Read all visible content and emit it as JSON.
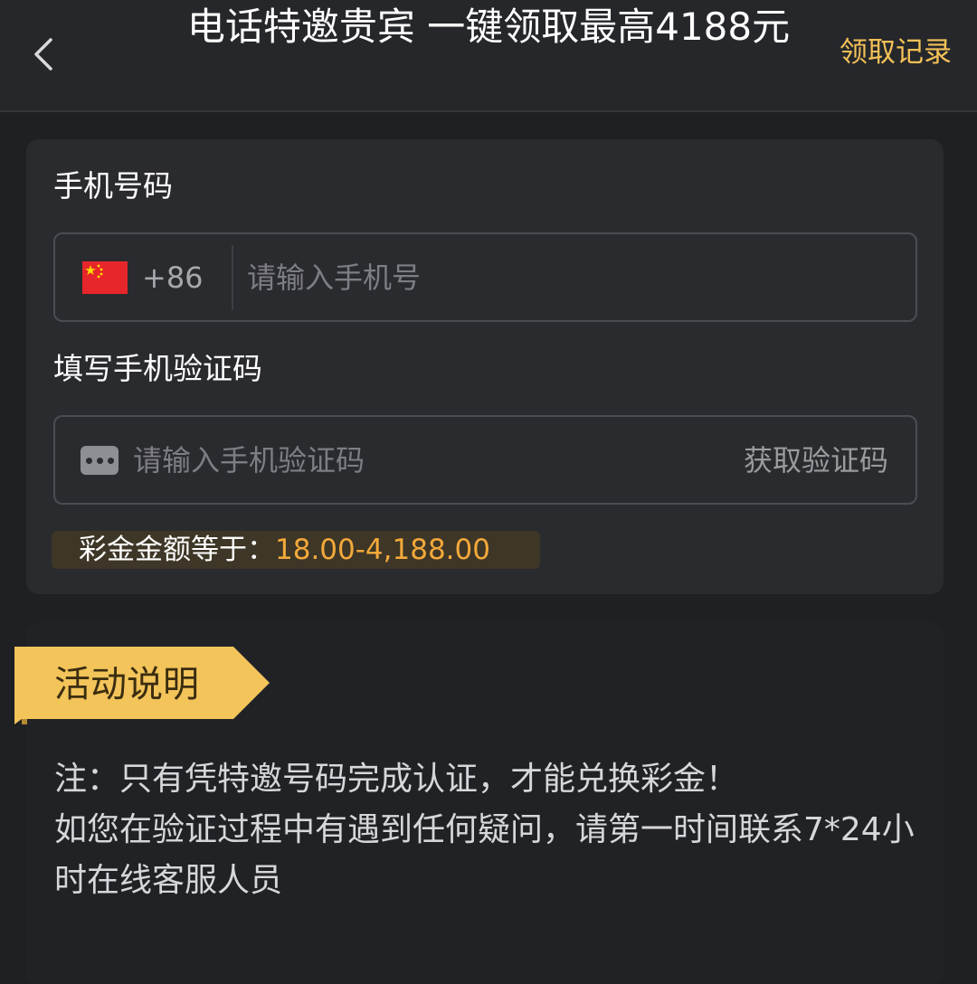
{
  "header": {
    "title": "电话特邀贵宾 一键领取最高4188元",
    "records_label": "领取记录"
  },
  "form": {
    "phone_label": "手机号码",
    "dial_code": "+86",
    "phone_placeholder": "请输入手机号",
    "code_label": "填写手机验证码",
    "code_placeholder": "请输入手机验证码",
    "get_code_label": "获取验证码",
    "bonus_label": "彩金金额等于：",
    "bonus_value": "18.00-4,188.00"
  },
  "activity": {
    "title": "活动说明",
    "lines": [
      "注：只有凭特邀号码完成认证，才能兑换彩金！",
      "如您在验证过程中有遇到任何疑问，请第一时间联系7*24小时在线客服人员"
    ]
  },
  "icons": {
    "back": "chevron-left-icon",
    "flag": "china-flag-icon",
    "sms": "message-dots-icon"
  },
  "colors": {
    "background": "#1f2024",
    "card": "#2a2b2f",
    "accent_gold": "#f3c157",
    "bonus_orange": "#f3a93a",
    "ribbon": "#f2c45a"
  }
}
